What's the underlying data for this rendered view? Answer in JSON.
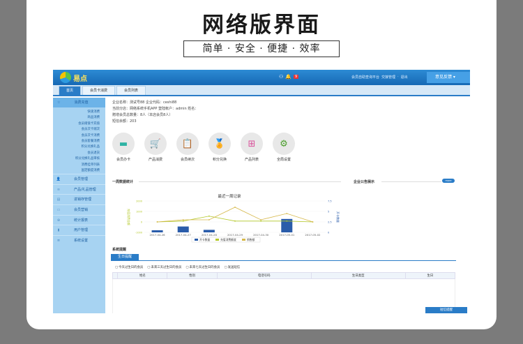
{
  "headline": "网络版界面",
  "slogan": "简单 · 安全 · 便捷 · 效率",
  "logo": {
    "text": "易点"
  },
  "topbar": {
    "badge": "9",
    "link1": "会员自助查询平台",
    "link2": "交接管理",
    "link3": "退出",
    "button": "意见反馈"
  },
  "tabs": [
    "首页",
    "会员卡消费",
    "会员列表"
  ],
  "sidebar": {
    "section": {
      "label": "消费充值"
    },
    "subitems": [
      "快速消费",
      "商品消费",
      "会员储值卡充值",
      "会员次卡储次",
      "会员次卡消费",
      "会员套餐消费",
      "积分兑换礼品",
      "会员退货",
      "积分兑换礼品审核",
      "消费挂单列表",
      "国定额度消费"
    ],
    "items": [
      {
        "label": "会员管理",
        "icon": "user-icon"
      },
      {
        "label": "产品/礼品管理",
        "icon": "layers-icon"
      },
      {
        "label": "进销存管理",
        "icon": "box-icon"
      },
      {
        "label": "会员营销",
        "icon": "display-icon"
      },
      {
        "label": "统计报表",
        "icon": "globe-icon"
      },
      {
        "label": "用户管理",
        "icon": "bars-icon"
      },
      {
        "label": "系统设置",
        "icon": "doc-icon"
      }
    ]
  },
  "info": {
    "line1": "企业名称：测试号88     企业代码：ceshi88",
    "line2": "当前分店：网络系统手机APP     登陆帐户：admin     姓名：",
    "line3": "赠增会员总数量：8人（本店会员8人）",
    "line4": "短信余额：203"
  },
  "apps": [
    {
      "label": "会员办卡",
      "icon": "card-icon"
    },
    {
      "label": "产品消费",
      "icon": "cart-icon"
    },
    {
      "label": "会员续次",
      "icon": "clipboard-icon"
    },
    {
      "label": "积分兑换",
      "icon": "award-icon"
    },
    {
      "label": "产品列表",
      "icon": "sitemap-icon"
    },
    {
      "label": "全局设置",
      "icon": "gear-icon"
    }
  ],
  "stats": {
    "title": "一周数据统计"
  },
  "notice": {
    "title": "企业公告展示",
    "more": "more"
  },
  "chart_data": {
    "type": "line",
    "title": "最近一周记录",
    "categories": [
      "2017-04-26",
      "2017-04-27",
      "2017-04-28",
      "2017-04-29",
      "2017-04-30",
      "2017-05-01",
      "2017-05-02"
    ],
    "ylim": [
      -1000,
      2000
    ],
    "yticks": [
      "2000",
      "1000",
      "0",
      "-1000"
    ],
    "y2ticks": [
      "7.5",
      "5",
      "2.5",
      "0"
    ],
    "ylabel": "充值消费金额",
    "y2label": "开卡数量",
    "series": [
      {
        "name": "开卡数量",
        "type": "bar",
        "values": [
          0.5,
          1.4,
          0.6,
          0,
          0,
          3.2,
          0
        ],
        "color": "#2a5caa"
      },
      {
        "name": "充值消费额度",
        "type": "line",
        "values": [
          0,
          80,
          550,
          80,
          80,
          80,
          0
        ],
        "color": "#b5c92c"
      },
      {
        "name": "销售额",
        "type": "line",
        "values": [
          0,
          200,
          200,
          1400,
          200,
          800,
          0
        ],
        "color": "#d6b84a"
      }
    ]
  },
  "report": {
    "title": "系统提醒",
    "tab": "生日提醒",
    "filters": [
      "今天过生日的会员",
      "未来三天过生日的会员",
      "未来七天过生日的会员",
      "发送短信"
    ],
    "columns": [
      "",
      "姓名",
      "性别",
      "电话号码",
      "生日类型",
      "生日"
    ],
    "bottom_button": "短信提醒"
  }
}
